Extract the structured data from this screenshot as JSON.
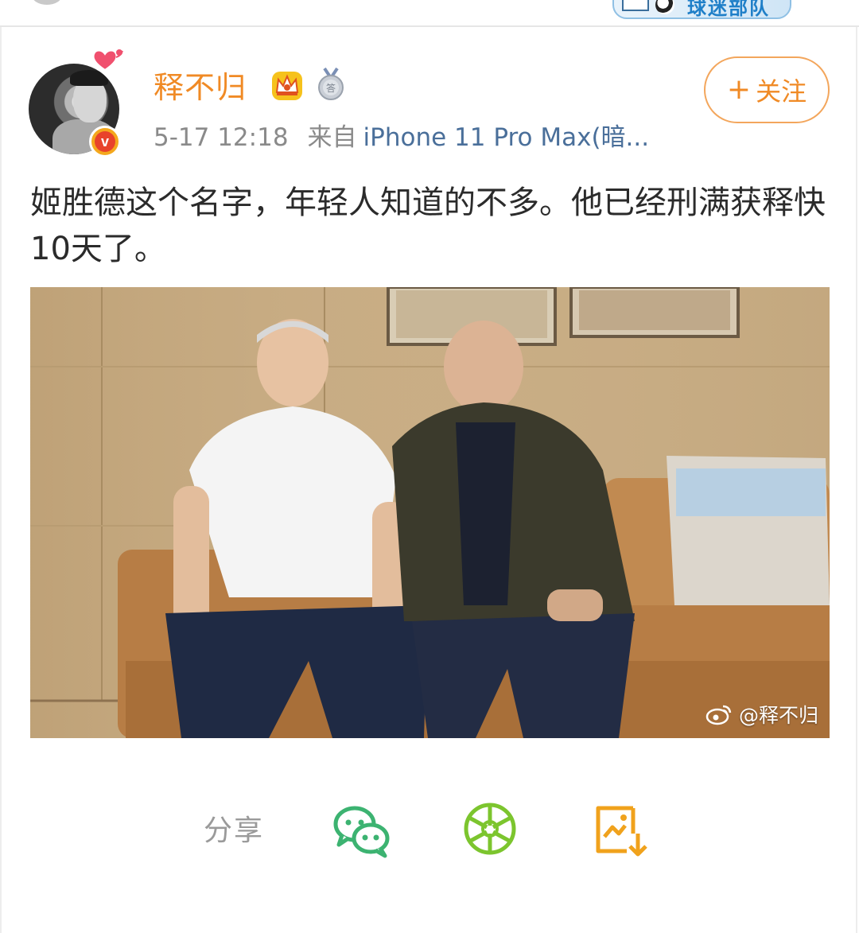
{
  "post": {
    "username": "释不归",
    "time": "5-17 12:18",
    "source_prefix": "来自",
    "device": "iPhone 11 Pro Max(暗...",
    "follow_label": "关注",
    "follow_plus": "+",
    "text": "姬胜德这个名字，年轻人知道的不多。他已经刑满获释快10天了。",
    "watermark": "@释不归"
  },
  "share": {
    "label": "分享",
    "items": [
      {
        "name": "wechat-icon"
      },
      {
        "name": "moments-icon"
      },
      {
        "name": "save-image-icon"
      }
    ]
  },
  "colors": {
    "accent": "#f08a25",
    "link": "#4a6f9a",
    "wechat": "#3cb371",
    "moments": "#7cc52e",
    "save": "#f0a21c"
  }
}
